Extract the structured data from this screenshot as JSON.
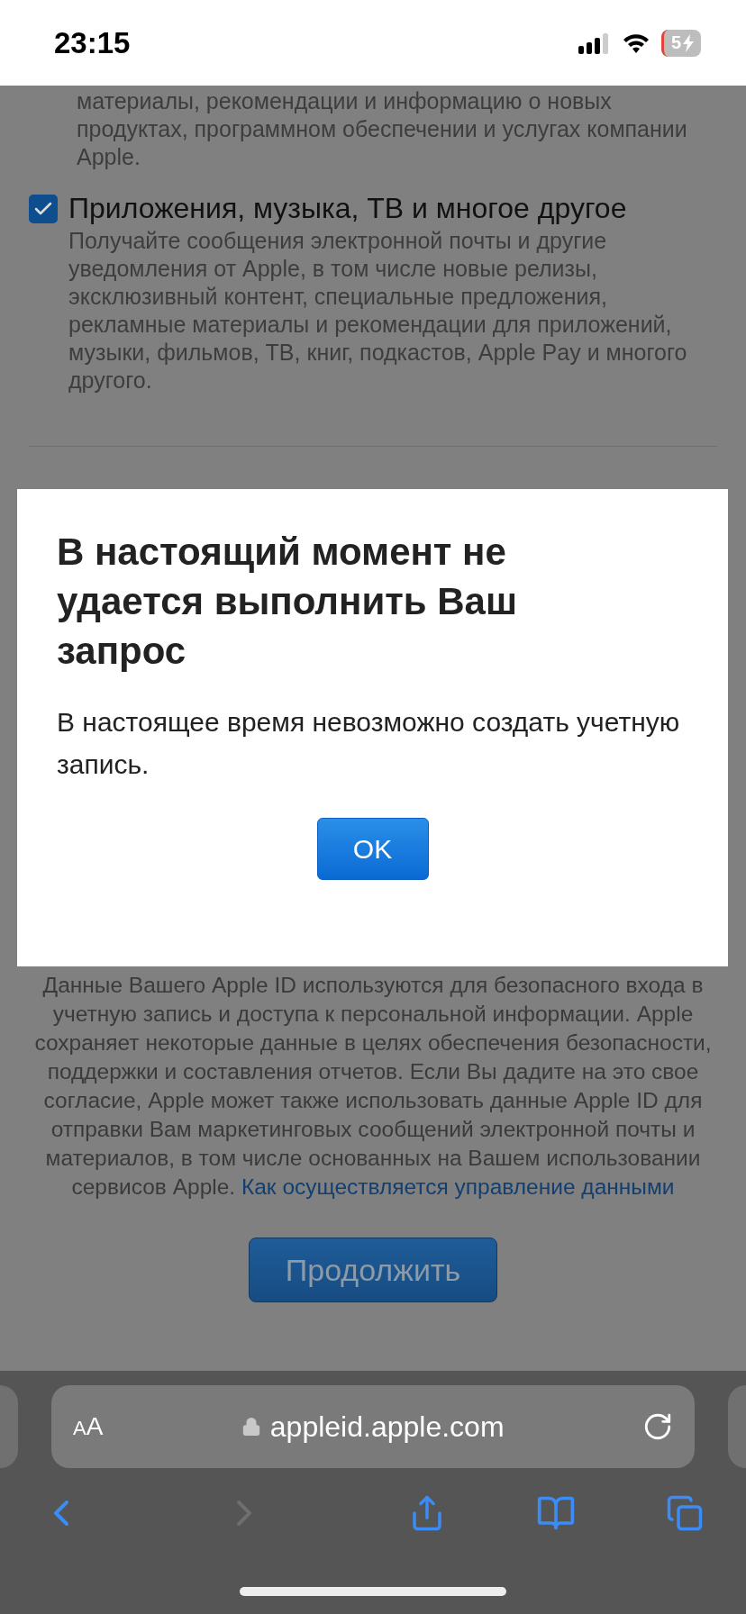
{
  "status_bar": {
    "time": "23:15",
    "battery": "5"
  },
  "page": {
    "intro_tail": "материалы, рекомендации и информацию о новых продуктах, программном обеспечении и услугах компании Apple.",
    "options": [
      {
        "label": "Приложения, музыка, ТВ и многое другое",
        "checked": true,
        "description": "Получайте сообщения электронной почты и другие уведомления от Apple, в том числе новые релизы, эксклюзивный контент, специальные предложения, рекламные материалы и рекомендации для приложений, музыки, фильмов, ТВ, книг, подкастов, Apple Pay и многого другого."
      }
    ],
    "privacy_text": "Данные Вашего Apple ID используются для безопасного входа в учетную запись и доступа к персональной информации. Apple сохраняет некоторые данные в целях обеспечения безопасности, поддержки и составления отчетов. Если Вы дадите на это свое согласие, Apple может также использовать данные Apple ID для отправки Вам маркетинговых сообщений электронной почты и материалов, в том числе основанных на Вашем использовании сервисов Apple.",
    "privacy_link": "Как осуществляется управление данными",
    "continue_button": "Продолжить"
  },
  "dialog": {
    "title": "В настоящий момент не удается выполнить Ваш запрос",
    "message": "В настоящее время невозможно создать учетную запись.",
    "button": "OK"
  },
  "browser": {
    "text_size_button": "AA",
    "url": "appleid.apple.com",
    "back": {
      "disabled": false
    },
    "forward": {
      "disabled": true
    }
  }
}
